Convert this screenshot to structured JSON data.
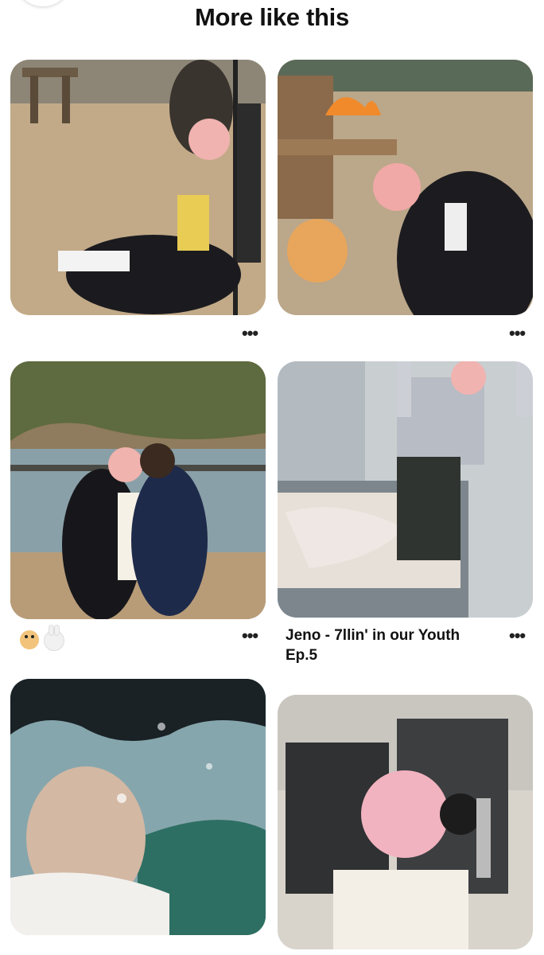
{
  "header": {
    "title": "More like this"
  },
  "pins": [
    {
      "id": "pin-1",
      "more_label": "•••",
      "title": ""
    },
    {
      "id": "pin-2",
      "more_label": "•••",
      "title": ""
    },
    {
      "id": "pin-3",
      "more_label": "•••",
      "title": "",
      "emoji_row": [
        "puppy-emoji",
        "rabbit-emoji"
      ]
    },
    {
      "id": "pin-4",
      "more_label": "•••",
      "title": "Jeno - 7llin' in our Youth Ep.5"
    },
    {
      "id": "pin-5",
      "more_label": "",
      "title": ""
    },
    {
      "id": "pin-6",
      "more_label": "",
      "title": ""
    }
  ],
  "colors": {
    "background": "#ffffff",
    "text": "#111111"
  }
}
